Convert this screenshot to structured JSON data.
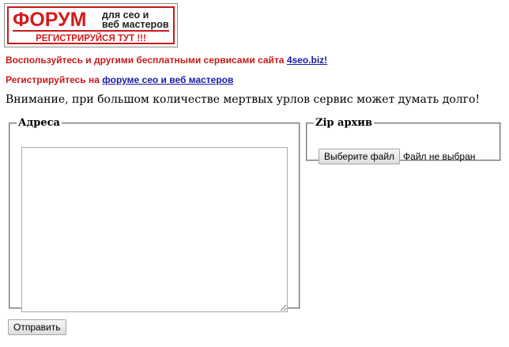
{
  "banner": {
    "big_text": "ФОРУМ",
    "small_line1": "для сео и",
    "small_line2": "веб мастеров",
    "cta": "РЕГИСТРИРУЙСЯ ТУТ !!!"
  },
  "promo": {
    "line1_text": "Воспользуйтесь и другими бесплатными сервисами сайта ",
    "line1_link": "4seo.biz!",
    "line2_text": "Регистрируйтесь на ",
    "line2_link": "форуме сео и веб мастеров"
  },
  "warning": "Внимание, при большом количестве мертвых урлов сервис может думать долго!",
  "addresses": {
    "legend": "Адреса",
    "value": ""
  },
  "zip": {
    "legend": "Zip архив",
    "choose_label": "Выберите файл",
    "status": "Файл не выбран"
  },
  "submit_label": "Отправить",
  "colors": {
    "brand_red": "#d31b1b",
    "link_blue": "#1a1aa6"
  }
}
